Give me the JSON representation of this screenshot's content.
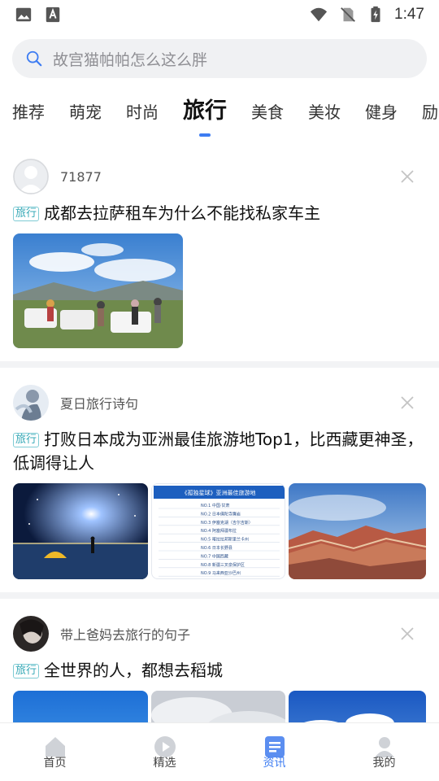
{
  "status_bar": {
    "time": "1:47",
    "icons": [
      "image-icon",
      "keyboard-a-icon",
      "wifi-icon",
      "no-sim-icon",
      "battery-charging-icon"
    ]
  },
  "search": {
    "placeholder": "故宫猫帕帕怎么这么胖"
  },
  "tabs": [
    {
      "label": "推荐"
    },
    {
      "label": "萌宠"
    },
    {
      "label": "时尚"
    },
    {
      "label": "旅行",
      "active": true
    },
    {
      "label": "美食"
    },
    {
      "label": "美妆"
    },
    {
      "label": "健身"
    },
    {
      "label": "励志"
    }
  ],
  "feed": [
    {
      "author": "71877",
      "tag": "旅行",
      "title": "成都去拉萨租车为什么不能找私家车主",
      "images": [
        "scenery-cars-photo"
      ]
    },
    {
      "author": "夏日旅行诗句",
      "tag": "旅行",
      "title": "打败日本成为亚洲最佳旅游地Top1，比西藏更神圣，低调得让人",
      "images": [
        "starry-night-photo",
        "ranking-list-image",
        "red-mountains-photo"
      ],
      "ranking_image": {
        "heading": "《孤独星球》亚洲最佳旅游地",
        "rows": [
          "NO.1 中国·甘肃",
          "NO.2 日本佛陀寺鹰岩",
          "NO.3 伊塞克湖（吉尔吉斯）",
          "NO.4 阿塞拜疆布拉",
          "NO.5 喀拉拉邦斯里兰卡州",
          "NO.6 日本长野县",
          "NO.7 中国西藏",
          "NO.8 新疆三叉泉保护区",
          "NO.9 马来西亚沙巴州"
        ]
      }
    },
    {
      "author": "带上爸妈去旅行的句子",
      "tag": "旅行",
      "title": "全世界的人，都想去稻城",
      "images": [
        "blue-sky-photo",
        "cloudy-sky-photo",
        "blue-clouds-photo"
      ]
    }
  ],
  "bottom_nav": [
    {
      "label": "首页",
      "icon": "home-icon"
    },
    {
      "label": "精选",
      "icon": "play-icon"
    },
    {
      "label": "资讯",
      "icon": "news-icon",
      "active": true
    },
    {
      "label": "我的",
      "icon": "profile-icon"
    }
  ],
  "colors": {
    "accent": "#3d7cf2",
    "tag": "#37a9b7",
    "search_bg": "#f0f1f3"
  }
}
